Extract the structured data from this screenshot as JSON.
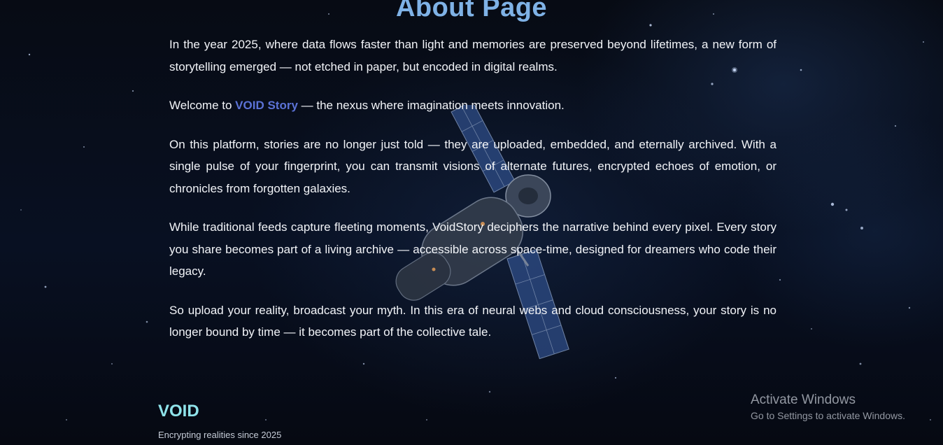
{
  "page": {
    "title": "About Page"
  },
  "about": {
    "p1": "In the year 2025, where data flows faster than light and memories are preserved beyond lifetimes, a new form of storytelling emerged — not etched in paper, but encoded in digital realms.",
    "p2_before": "Welcome to ",
    "p2_link": "VOID Story",
    "p2_after": " — the nexus where imagination meets innovation.",
    "p3": "On this platform, stories are no longer just told — they are uploaded, embedded, and eternally archived. With a single pulse of your fingerprint, you can transmit visions of alternate futures, encrypted echoes of emotion, or chronicles from forgotten galaxies.",
    "p4": "While traditional feeds capture fleeting moments, VoidStory deciphers the narrative behind every pixel. Every story you share becomes part of a living archive — accessible across space-time, designed for dreamers who code their legacy.",
    "p5": "So upload your reality, broadcast your myth. In this era of neural webs and cloud consciousness, your story is no longer bound by time — it becomes part of the collective tale."
  },
  "footer": {
    "logo": "VOID",
    "tagline": "Encrypting realities since 2025"
  },
  "windows_activation": {
    "title": "Activate Windows",
    "subtitle": "Go to Settings to activate Windows."
  },
  "colors": {
    "title": "#7fb2e6",
    "link": "#5b72d6",
    "footer_logo": "#8fe3ea",
    "background": "#05080f"
  }
}
